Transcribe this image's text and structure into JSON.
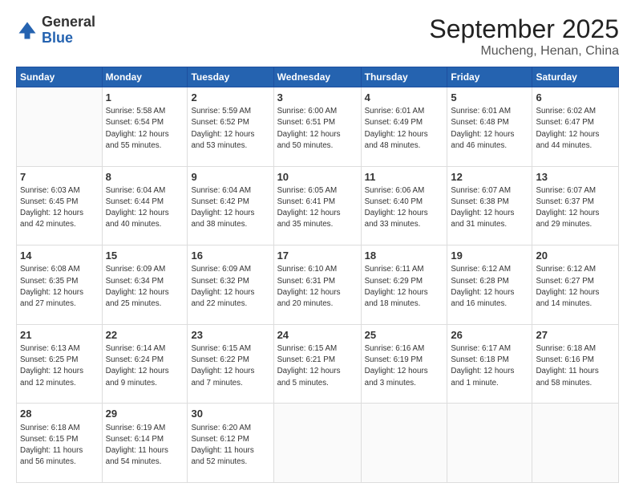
{
  "header": {
    "logo_general": "General",
    "logo_blue": "Blue",
    "month_title": "September 2025",
    "location": "Mucheng, Henan, China"
  },
  "weekdays": [
    "Sunday",
    "Monday",
    "Tuesday",
    "Wednesday",
    "Thursday",
    "Friday",
    "Saturday"
  ],
  "weeks": [
    [
      {
        "day": "",
        "info": ""
      },
      {
        "day": "1",
        "info": "Sunrise: 5:58 AM\nSunset: 6:54 PM\nDaylight: 12 hours\nand 55 minutes."
      },
      {
        "day": "2",
        "info": "Sunrise: 5:59 AM\nSunset: 6:52 PM\nDaylight: 12 hours\nand 53 minutes."
      },
      {
        "day": "3",
        "info": "Sunrise: 6:00 AM\nSunset: 6:51 PM\nDaylight: 12 hours\nand 50 minutes."
      },
      {
        "day": "4",
        "info": "Sunrise: 6:01 AM\nSunset: 6:49 PM\nDaylight: 12 hours\nand 48 minutes."
      },
      {
        "day": "5",
        "info": "Sunrise: 6:01 AM\nSunset: 6:48 PM\nDaylight: 12 hours\nand 46 minutes."
      },
      {
        "day": "6",
        "info": "Sunrise: 6:02 AM\nSunset: 6:47 PM\nDaylight: 12 hours\nand 44 minutes."
      }
    ],
    [
      {
        "day": "7",
        "info": "Sunrise: 6:03 AM\nSunset: 6:45 PM\nDaylight: 12 hours\nand 42 minutes."
      },
      {
        "day": "8",
        "info": "Sunrise: 6:04 AM\nSunset: 6:44 PM\nDaylight: 12 hours\nand 40 minutes."
      },
      {
        "day": "9",
        "info": "Sunrise: 6:04 AM\nSunset: 6:42 PM\nDaylight: 12 hours\nand 38 minutes."
      },
      {
        "day": "10",
        "info": "Sunrise: 6:05 AM\nSunset: 6:41 PM\nDaylight: 12 hours\nand 35 minutes."
      },
      {
        "day": "11",
        "info": "Sunrise: 6:06 AM\nSunset: 6:40 PM\nDaylight: 12 hours\nand 33 minutes."
      },
      {
        "day": "12",
        "info": "Sunrise: 6:07 AM\nSunset: 6:38 PM\nDaylight: 12 hours\nand 31 minutes."
      },
      {
        "day": "13",
        "info": "Sunrise: 6:07 AM\nSunset: 6:37 PM\nDaylight: 12 hours\nand 29 minutes."
      }
    ],
    [
      {
        "day": "14",
        "info": "Sunrise: 6:08 AM\nSunset: 6:35 PM\nDaylight: 12 hours\nand 27 minutes."
      },
      {
        "day": "15",
        "info": "Sunrise: 6:09 AM\nSunset: 6:34 PM\nDaylight: 12 hours\nand 25 minutes."
      },
      {
        "day": "16",
        "info": "Sunrise: 6:09 AM\nSunset: 6:32 PM\nDaylight: 12 hours\nand 22 minutes."
      },
      {
        "day": "17",
        "info": "Sunrise: 6:10 AM\nSunset: 6:31 PM\nDaylight: 12 hours\nand 20 minutes."
      },
      {
        "day": "18",
        "info": "Sunrise: 6:11 AM\nSunset: 6:29 PM\nDaylight: 12 hours\nand 18 minutes."
      },
      {
        "day": "19",
        "info": "Sunrise: 6:12 AM\nSunset: 6:28 PM\nDaylight: 12 hours\nand 16 minutes."
      },
      {
        "day": "20",
        "info": "Sunrise: 6:12 AM\nSunset: 6:27 PM\nDaylight: 12 hours\nand 14 minutes."
      }
    ],
    [
      {
        "day": "21",
        "info": "Sunrise: 6:13 AM\nSunset: 6:25 PM\nDaylight: 12 hours\nand 12 minutes."
      },
      {
        "day": "22",
        "info": "Sunrise: 6:14 AM\nSunset: 6:24 PM\nDaylight: 12 hours\nand 9 minutes."
      },
      {
        "day": "23",
        "info": "Sunrise: 6:15 AM\nSunset: 6:22 PM\nDaylight: 12 hours\nand 7 minutes."
      },
      {
        "day": "24",
        "info": "Sunrise: 6:15 AM\nSunset: 6:21 PM\nDaylight: 12 hours\nand 5 minutes."
      },
      {
        "day": "25",
        "info": "Sunrise: 6:16 AM\nSunset: 6:19 PM\nDaylight: 12 hours\nand 3 minutes."
      },
      {
        "day": "26",
        "info": "Sunrise: 6:17 AM\nSunset: 6:18 PM\nDaylight: 12 hours\nand 1 minute."
      },
      {
        "day": "27",
        "info": "Sunrise: 6:18 AM\nSunset: 6:16 PM\nDaylight: 11 hours\nand 58 minutes."
      }
    ],
    [
      {
        "day": "28",
        "info": "Sunrise: 6:18 AM\nSunset: 6:15 PM\nDaylight: 11 hours\nand 56 minutes."
      },
      {
        "day": "29",
        "info": "Sunrise: 6:19 AM\nSunset: 6:14 PM\nDaylight: 11 hours\nand 54 minutes."
      },
      {
        "day": "30",
        "info": "Sunrise: 6:20 AM\nSunset: 6:12 PM\nDaylight: 11 hours\nand 52 minutes."
      },
      {
        "day": "",
        "info": ""
      },
      {
        "day": "",
        "info": ""
      },
      {
        "day": "",
        "info": ""
      },
      {
        "day": "",
        "info": ""
      }
    ]
  ]
}
